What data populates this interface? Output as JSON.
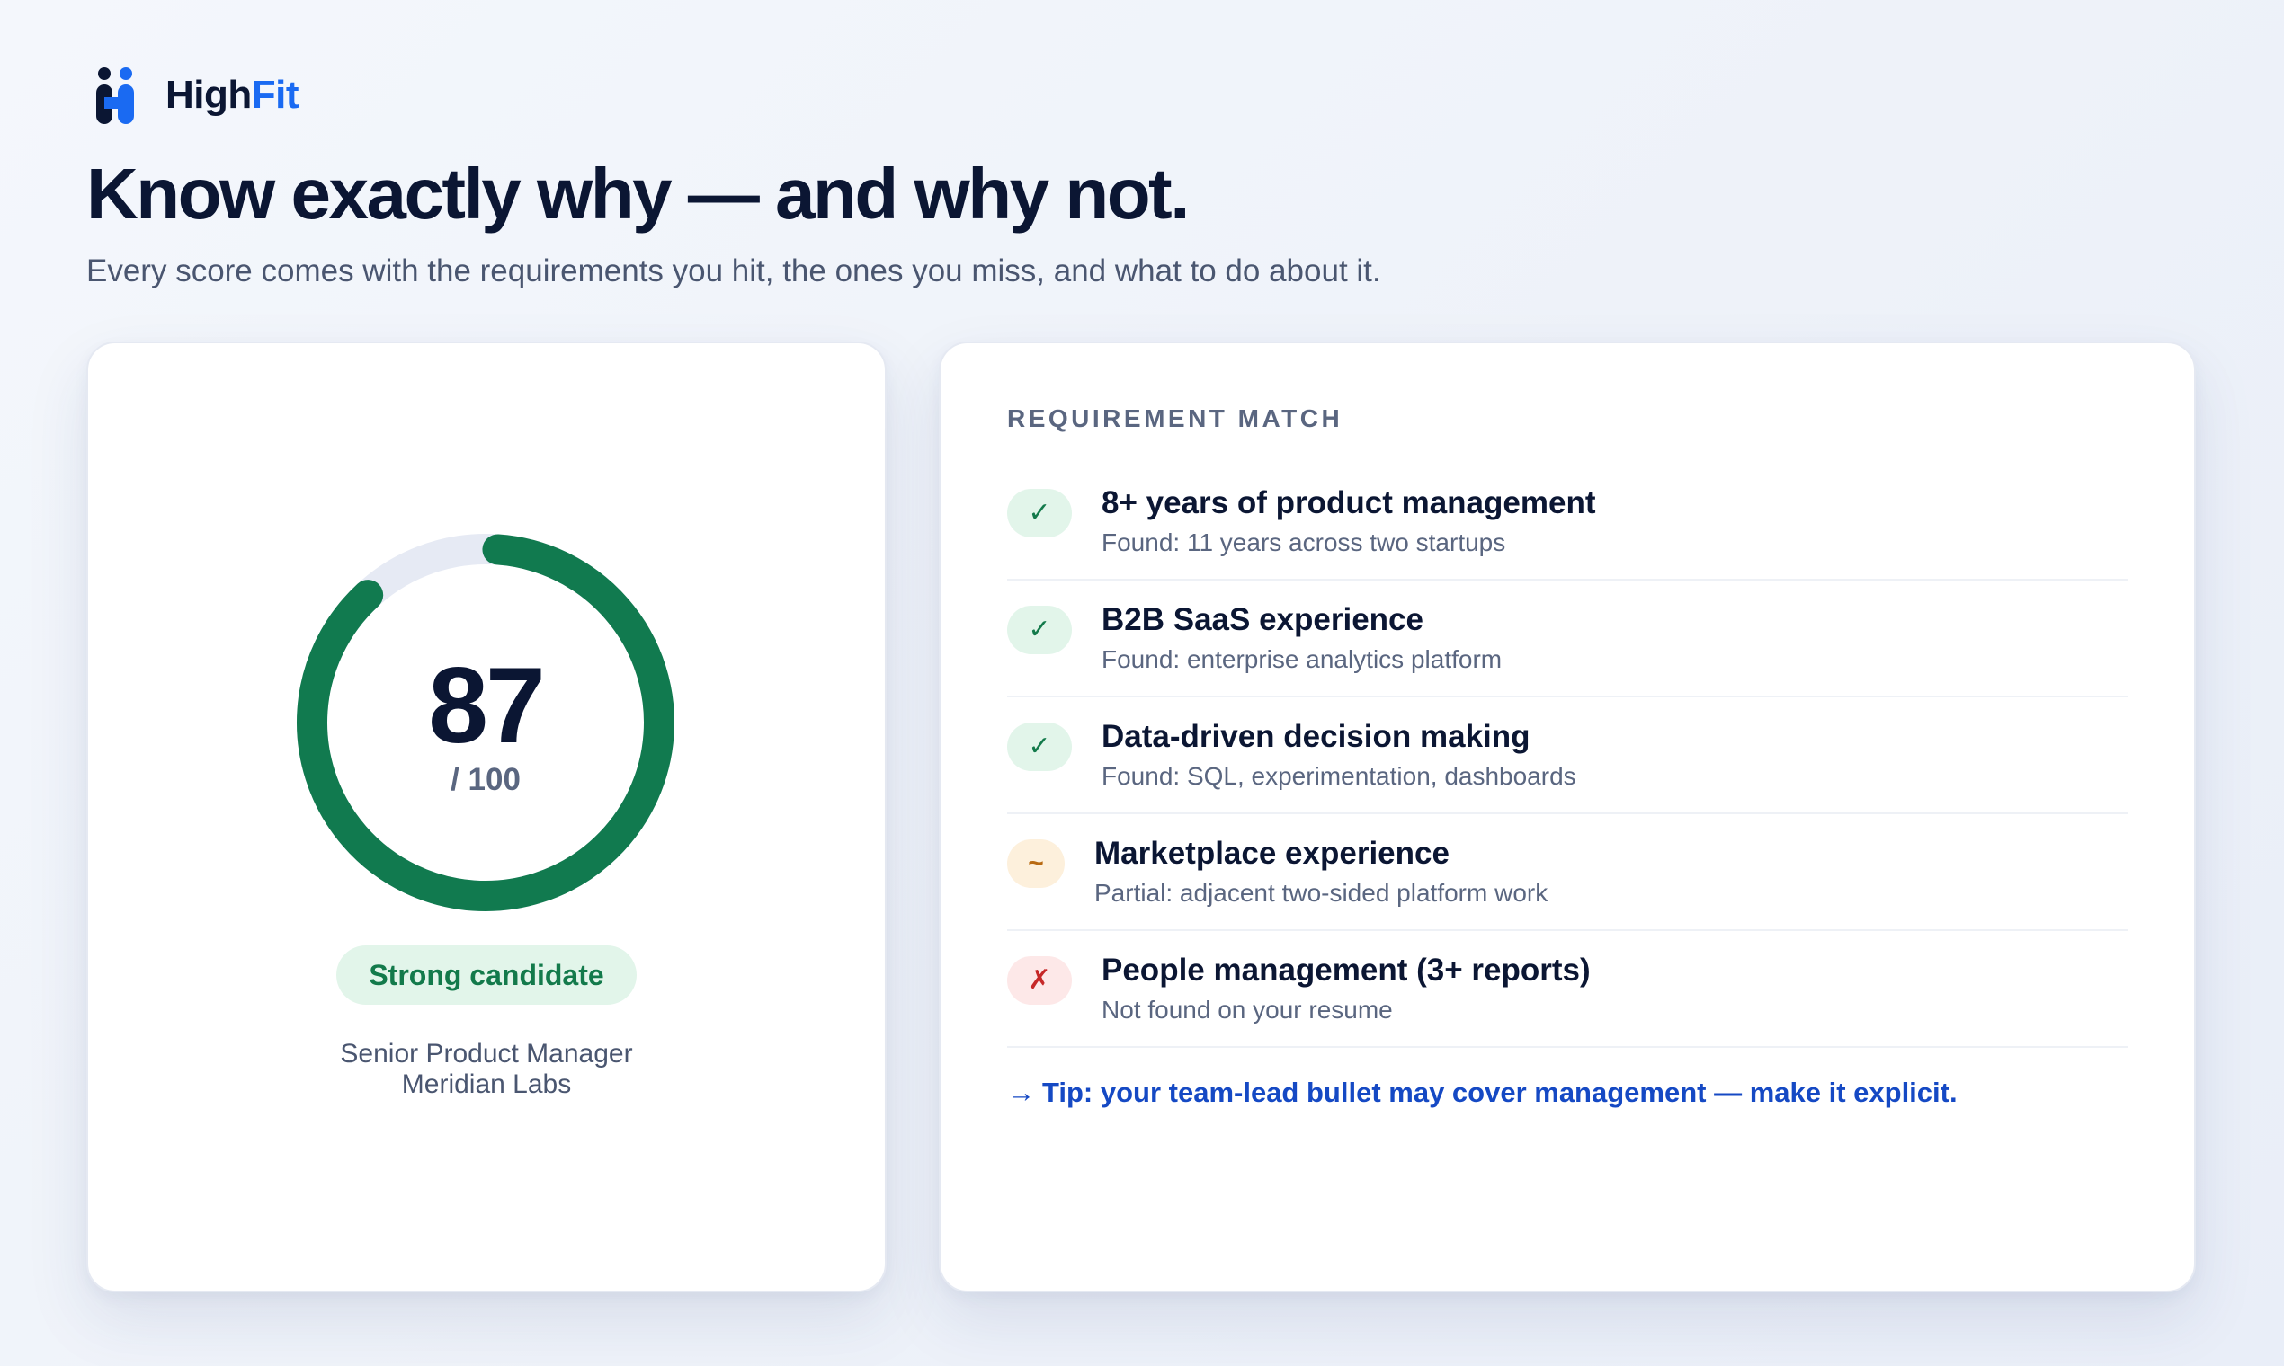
{
  "brand": {
    "name_part1": "High",
    "name_part2": "Fit",
    "logo_icon": "highfit-logo-icon"
  },
  "hero": {
    "headline": "Know exactly why — and why not.",
    "subheadline": "Every score comes with the requirements you hit, the ones you miss, and what to do about it."
  },
  "score": {
    "value": "87",
    "max_label": "/ 100",
    "fraction": 0.87,
    "badge": "Strong candidate",
    "role_title": "Senior Product Manager",
    "company": "Meridian Labs"
  },
  "requirements": {
    "section_label": "REQUIREMENT MATCH",
    "items": [
      {
        "status": "met",
        "icon": "✓",
        "icon_name": "check-icon",
        "title": "8+ years of product management",
        "detail": "Found: 11 years across two startups"
      },
      {
        "status": "met",
        "icon": "✓",
        "icon_name": "check-icon",
        "title": "B2B SaaS experience",
        "detail": "Found: enterprise analytics platform"
      },
      {
        "status": "met",
        "icon": "✓",
        "icon_name": "check-icon",
        "title": "Data-driven decision making",
        "detail": "Found: SQL, experimentation, dashboards"
      },
      {
        "status": "partial",
        "icon": "~",
        "icon_name": "partial-icon",
        "title": "Marketplace experience",
        "detail": "Partial: adjacent two-sided platform work"
      },
      {
        "status": "missing",
        "icon": "✗",
        "icon_name": "cross-icon",
        "title": "People management (3+ reports)",
        "detail": "Not found on your resume"
      }
    ],
    "tip_arrow": "→",
    "tip": "Tip: your team-lead bullet may cover management — make it explicit."
  },
  "colors": {
    "accent": "#1a6af2",
    "ink": "#0b1633",
    "score_green": "#117a4f",
    "ring_track": "#e6eaf4",
    "tip_blue": "#1549c4"
  }
}
